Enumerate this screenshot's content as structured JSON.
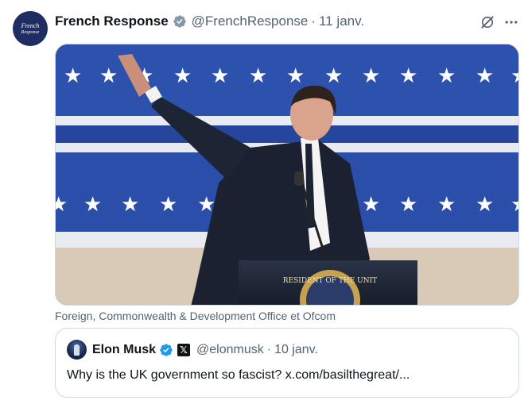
{
  "tweet": {
    "avatar_text": [
      "French",
      "Response"
    ],
    "display_name": "French Response",
    "handle": "@FrenchResponse",
    "separator": "·",
    "date": "11 janv.",
    "icons": {
      "verified": "verified-badge-icon",
      "grok": "grok-icon",
      "more": "more-icon"
    }
  },
  "media": {
    "caption": "Foreign, Commonwealth & Development Office et Ofcom",
    "seal_text": "RESIDENT OF THE UNIT"
  },
  "quote": {
    "display_name": "Elon Musk",
    "badge": "𝕏",
    "handle": "@elonmusk",
    "separator": "·",
    "date": "10 janv.",
    "text": "Why is the UK government so fascist? x.com/basilthegreat/..."
  },
  "colors": {
    "verified_blue": "#1d9bf0",
    "secondary_text": "#536471",
    "border": "#cfd9de"
  }
}
